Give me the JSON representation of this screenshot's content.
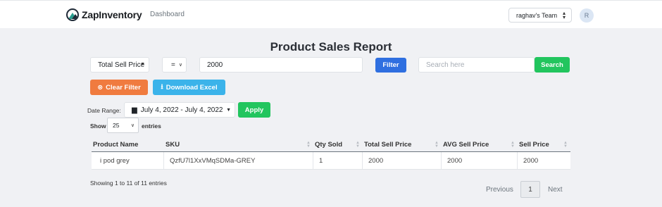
{
  "app": {
    "brand": "ZapInventory",
    "nav": [
      "Dashboard"
    ],
    "team": "raghav's Team",
    "avatar_initial": "R"
  },
  "report": {
    "title": "Product Sales Report",
    "filter": {
      "column_selected": "Total Sell Price",
      "operator_selected": "=",
      "value": "2000",
      "filter_button": "Filter",
      "search_placeholder": "Search here",
      "search_button": "Search"
    },
    "actions": {
      "clear_filter": "Clear Filter",
      "download_excel": "Download Excel"
    },
    "date": {
      "label": "Date Range:",
      "value": "July 4, 2022 - July 4, 2022",
      "apply": "Apply"
    },
    "entries": {
      "show_label": "Show",
      "selected": "25",
      "suffix": "entries"
    },
    "table": {
      "columns": [
        "Product Name",
        "SKU",
        "Qty Sold",
        "Total Sell Price",
        "AVG Sell Price",
        "Sell Price"
      ],
      "rows": [
        [
          "i pod grey",
          "QzfU7l1XxVMqSDMa-GREY",
          "1",
          "2000",
          "2000",
          "2000"
        ]
      ]
    },
    "info": "Showing 1 to 11 of 11 entries",
    "pagination": {
      "previous": "Previous",
      "current": "1",
      "next": "Next"
    }
  },
  "colors": {
    "filter": "#2f6fe0",
    "search": "#22c55e",
    "clear": "#f07b3f",
    "excel": "#3bb3ea",
    "apply": "#22c55e",
    "background": "#f0f1f4"
  }
}
